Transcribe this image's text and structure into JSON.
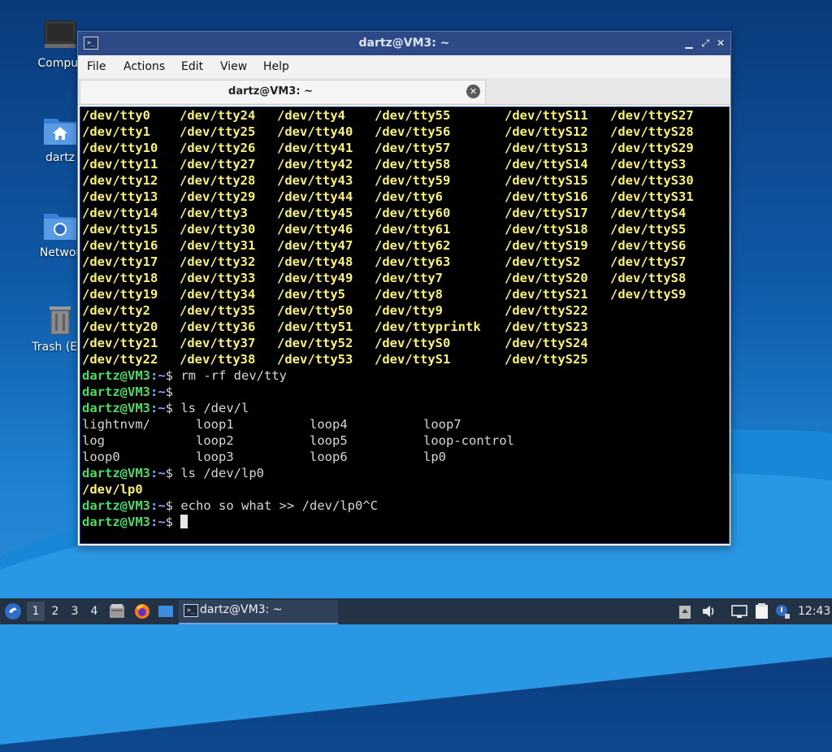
{
  "desktop": {
    "icons": [
      {
        "label": "Comput",
        "icon": "computer-icon"
      },
      {
        "label": "dartz",
        "icon": "home-folder-icon"
      },
      {
        "label": "Networ",
        "icon": "network-folder-icon"
      },
      {
        "label": "Trash (Em",
        "icon": "trash-icon"
      }
    ]
  },
  "window": {
    "title": "dartz@VM3: ~",
    "menu": [
      "File",
      "Actions",
      "Edit",
      "View",
      "Help"
    ],
    "tab_label": "dartz@VM3: ~"
  },
  "terminal": {
    "tty_rows": [
      [
        "/dev/tty0",
        "/dev/tty24",
        "/dev/tty4",
        "/dev/tty55",
        "/dev/ttyS11",
        "/dev/ttyS27"
      ],
      [
        "/dev/tty1",
        "/dev/tty25",
        "/dev/tty40",
        "/dev/tty56",
        "/dev/ttyS12",
        "/dev/ttyS28"
      ],
      [
        "/dev/tty10",
        "/dev/tty26",
        "/dev/tty41",
        "/dev/tty57",
        "/dev/ttyS13",
        "/dev/ttyS29"
      ],
      [
        "/dev/tty11",
        "/dev/tty27",
        "/dev/tty42",
        "/dev/tty58",
        "/dev/ttyS14",
        "/dev/ttyS3"
      ],
      [
        "/dev/tty12",
        "/dev/tty28",
        "/dev/tty43",
        "/dev/tty59",
        "/dev/ttyS15",
        "/dev/ttyS30"
      ],
      [
        "/dev/tty13",
        "/dev/tty29",
        "/dev/tty44",
        "/dev/tty6",
        "/dev/ttyS16",
        "/dev/ttyS31"
      ],
      [
        "/dev/tty14",
        "/dev/tty3",
        "/dev/tty45",
        "/dev/tty60",
        "/dev/ttyS17",
        "/dev/ttyS4"
      ],
      [
        "/dev/tty15",
        "/dev/tty30",
        "/dev/tty46",
        "/dev/tty61",
        "/dev/ttyS18",
        "/dev/ttyS5"
      ],
      [
        "/dev/tty16",
        "/dev/tty31",
        "/dev/tty47",
        "/dev/tty62",
        "/dev/ttyS19",
        "/dev/ttyS6"
      ],
      [
        "/dev/tty17",
        "/dev/tty32",
        "/dev/tty48",
        "/dev/tty63",
        "/dev/ttyS2",
        "/dev/ttyS7"
      ],
      [
        "/dev/tty18",
        "/dev/tty33",
        "/dev/tty49",
        "/dev/tty7",
        "/dev/ttyS20",
        "/dev/ttyS8"
      ],
      [
        "/dev/tty19",
        "/dev/tty34",
        "/dev/tty5",
        "/dev/tty8",
        "/dev/ttyS21",
        "/dev/ttyS9"
      ],
      [
        "/dev/tty2",
        "/dev/tty35",
        "/dev/tty50",
        "/dev/tty9",
        "/dev/ttyS22",
        ""
      ],
      [
        "/dev/tty20",
        "/dev/tty36",
        "/dev/tty51",
        "/dev/ttyprintk",
        "/dev/ttyS23",
        ""
      ],
      [
        "/dev/tty21",
        "/dev/tty37",
        "/dev/tty52",
        "/dev/ttyS0",
        "/dev/ttyS24",
        ""
      ],
      [
        "/dev/tty22",
        "/dev/tty38",
        "/dev/tty53",
        "/dev/ttyS1",
        "/dev/ttyS25",
        ""
      ]
    ],
    "prompt_user": "dartz@VM3",
    "prompt_path": ":~",
    "prompt_sign": "$",
    "cmd1": " rm -rf dev/tty",
    "cmd2": "",
    "cmd3": " ls /dev/l",
    "ls_rows": [
      [
        "lightnvm/",
        "loop1",
        "loop4",
        "loop7"
      ],
      [
        "log",
        "loop2",
        "loop5",
        "loop-control"
      ],
      [
        "loop0",
        "loop3",
        "loop6",
        "lp0"
      ]
    ],
    "cmd4": " ls /dev/lp0",
    "out4": "/dev/lp0",
    "cmd5": " echo so what >> /dev/lp0^C",
    "cmd6": " "
  },
  "taskbar": {
    "workspaces": [
      "1",
      "2",
      "3",
      "4"
    ],
    "task_label": "dartz@VM3: ~",
    "clock": "12:43"
  },
  "colors": {
    "tty_yellow": "#f7f07a",
    "prompt_green": "#4cd964",
    "path_blue": "#8aa8ff",
    "title_bar": "#2e4a86"
  }
}
